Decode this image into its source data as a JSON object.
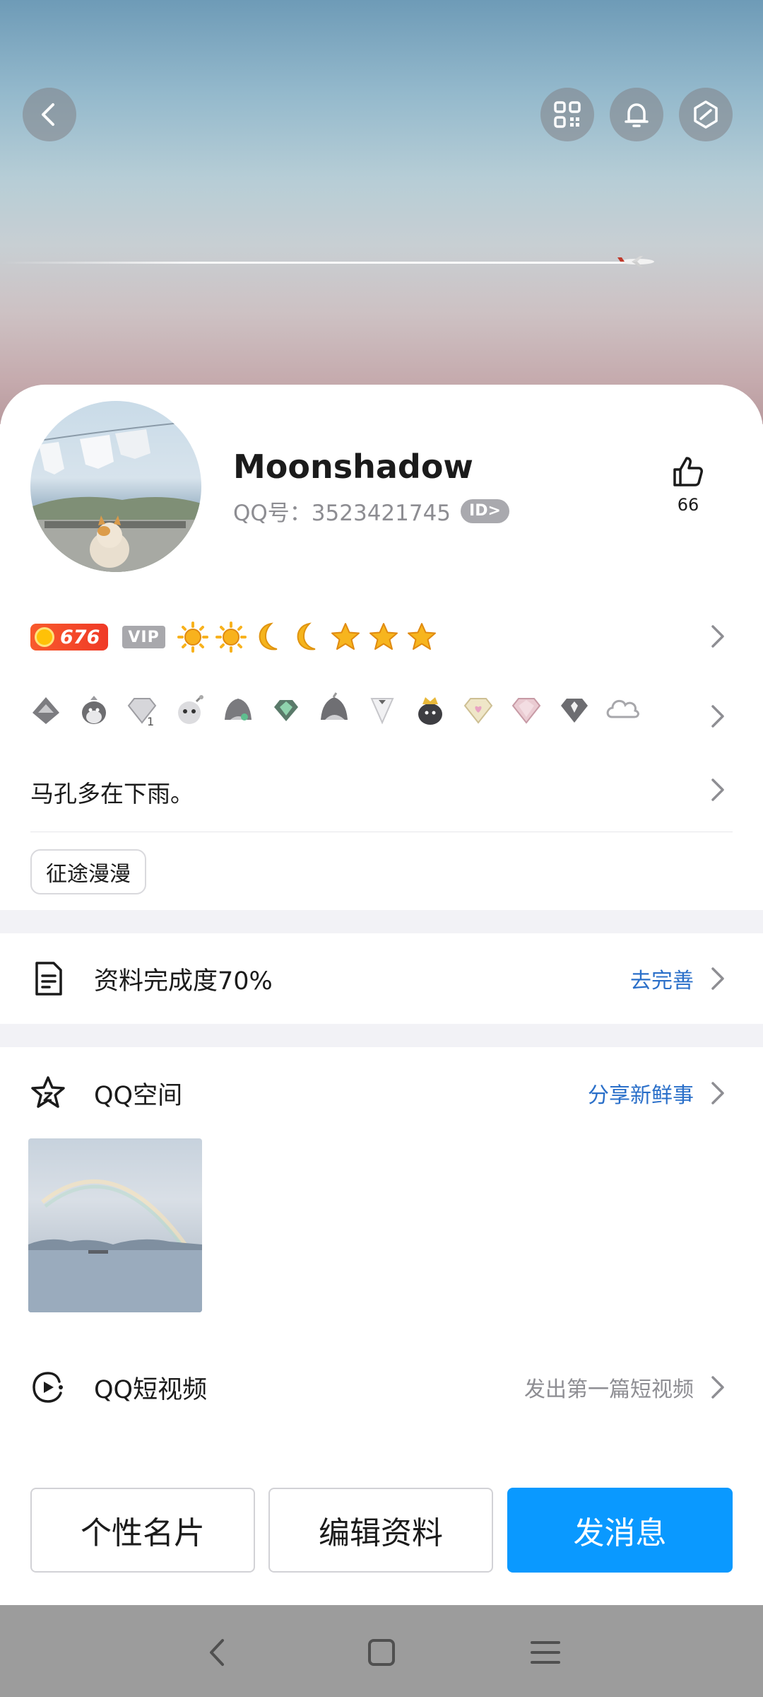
{
  "header": {
    "back_icon": "chevron-left-icon",
    "actions": [
      {
        "icon": "qr-code-icon"
      },
      {
        "icon": "bell-icon"
      },
      {
        "icon": "hexagon-slash-icon"
      }
    ]
  },
  "profile": {
    "name": "Moonshadow",
    "qq_number": "QQ号：3523421745",
    "id_badge": "ID>",
    "likes": "66",
    "level": "676",
    "vip_label": "VIP",
    "level_icons": [
      "sun",
      "sun",
      "moon",
      "moon",
      "star",
      "star",
      "star"
    ],
    "signature": "马孔多在下雨。",
    "tag": "征途漫漫"
  },
  "rows": {
    "completeness": {
      "label": "资料完成度70%",
      "action": "去完善",
      "icon": "document-icon"
    },
    "qzone": {
      "label": "QQ空间",
      "action": "分享新鲜事",
      "icon": "star-outline-icon"
    },
    "short_video": {
      "label": "QQ短视频",
      "action": "发出第一篇短视频",
      "icon": "video-icon"
    }
  },
  "buttons": {
    "card": "个性名片",
    "edit": "编辑资料",
    "message": "发消息"
  },
  "colors": {
    "primary": "#0a99ff",
    "link": "#2a6fc9",
    "level_badge": "#f03a27"
  }
}
